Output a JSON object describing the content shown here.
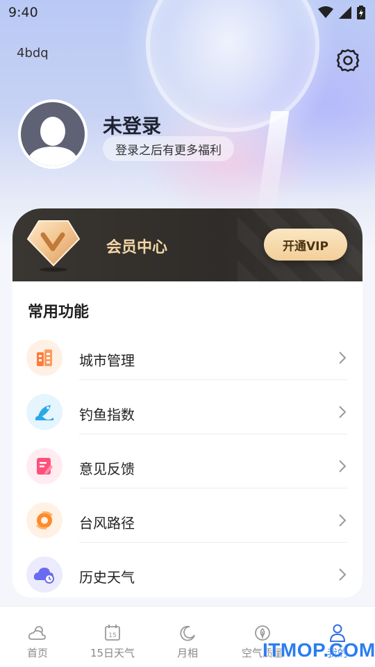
{
  "status_bar": {
    "time": "9:40"
  },
  "header": {
    "top_left_text": "4bdq"
  },
  "user": {
    "name": "未登录",
    "subtitle": "登录之后有更多福利"
  },
  "vip": {
    "title": "会员中心",
    "button_label": "开通VIP"
  },
  "functions": {
    "title": "常用功能",
    "items": [
      {
        "label": "城市管理",
        "icon": "city-building-icon",
        "color": "#ff7a3d"
      },
      {
        "label": "钓鱼指数",
        "icon": "fishing-icon",
        "color": "#2aa8e8"
      },
      {
        "label": "意见反馈",
        "icon": "feedback-icon",
        "color": "#ff4f7a"
      },
      {
        "label": "台风路径",
        "icon": "typhoon-icon",
        "color": "#ff8a2a"
      },
      {
        "label": "历史天气",
        "icon": "history-weather-icon",
        "color": "#6a6cf0"
      }
    ]
  },
  "tabbar": {
    "tabs": [
      {
        "label": "首页",
        "icon": "weather-home-icon"
      },
      {
        "label": "15日天气",
        "icon": "calendar-15-icon"
      },
      {
        "label": "月相",
        "icon": "moon-icon"
      },
      {
        "label": "空气质量",
        "icon": "leaf-icon"
      },
      {
        "label": "我的",
        "icon": "profile-icon",
        "active": true
      }
    ]
  },
  "watermark": "ITMOP.COM",
  "colors": {
    "accent": "#2f6ce5",
    "vip_gold": "#f3d7a6",
    "vip_bg": "#34312d"
  }
}
